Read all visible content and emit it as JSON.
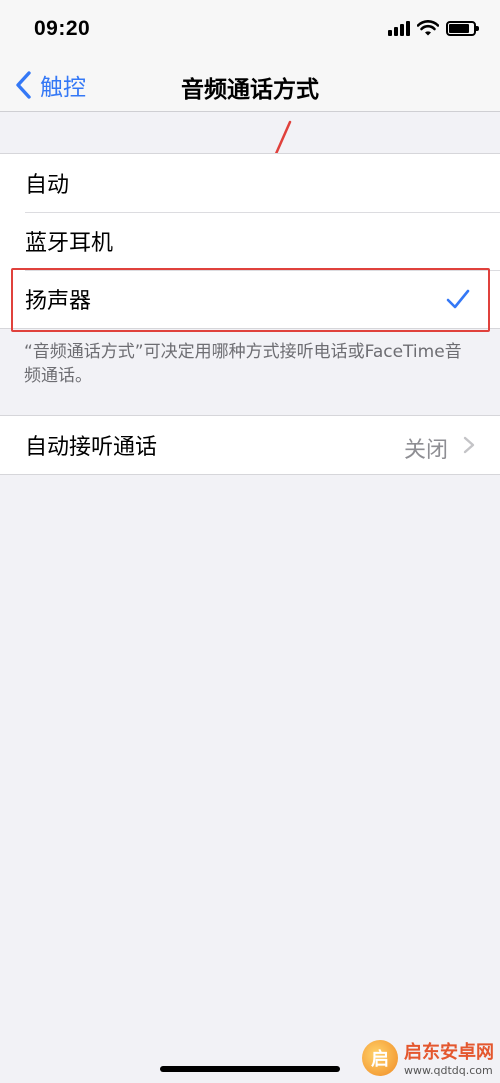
{
  "status": {
    "time": "09:20"
  },
  "nav": {
    "back_label": "触控",
    "title": "音频通话方式"
  },
  "audio_routing": {
    "options": [
      {
        "label": "自动",
        "selected": false
      },
      {
        "label": "蓝牙耳机",
        "selected": false
      },
      {
        "label": "扬声器",
        "selected": true
      }
    ],
    "footnote": "“音频通话方式”可决定用哪种方式接听电话或FaceTime音频通话。"
  },
  "auto_answer": {
    "label": "自动接听通话",
    "value": "关闭"
  },
  "watermark": {
    "name": "启东安卓网",
    "url": "www.qdtdq.com"
  },
  "colors": {
    "accent": "#3478f6",
    "annotation": "#e0413c",
    "background": "#f2f2f6"
  },
  "icons": [
    "signal-icon",
    "wifi-icon",
    "battery-icon",
    "chevron-left-icon",
    "checkmark-icon",
    "chevron-right-icon"
  ]
}
